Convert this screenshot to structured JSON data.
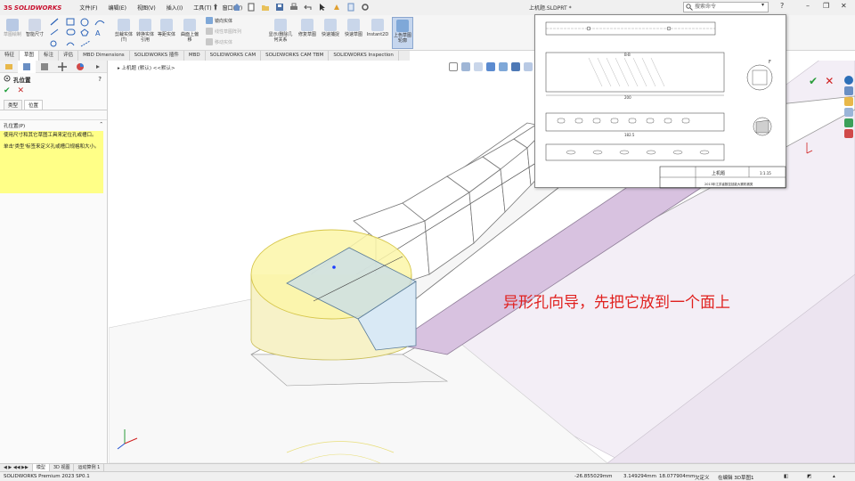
{
  "app": {
    "brand_prefix": "3S",
    "brand": "SOLIDWORKS",
    "document_title": "上机题.SLDPRT *",
    "search_placeholder": "搜索命令"
  },
  "menu": [
    "文件(F)",
    "编辑(E)",
    "视图(V)",
    "插入(I)",
    "工具(T)",
    "窗口(W)"
  ],
  "ribbon": {
    "smart_dim": "智能尺寸",
    "sketch_label": "草图绘制",
    "trim": "剪裁实体(T)",
    "convert": "转换实体引用",
    "offset": "等距实体",
    "surface_offset": "曲面上偏移",
    "mirror": "镜向实体",
    "linear_pattern": "线性草图阵列",
    "move": "移动实体",
    "show_relations": "显示/删除几何关系",
    "repair": "修复草图",
    "quick_snap": "快速捕捉",
    "quick_sketch": "快速草图",
    "instant2d": "Instant2D",
    "shaded_sketch": "上色草图轮廓"
  },
  "tabs": [
    "特征",
    "草图",
    "标注",
    "评估",
    "MBD Dimensions",
    "SOLIDWORKS 插件",
    "MBD",
    "SOLIDWORKS CAM",
    "SOLIDWORKS CAM TBM",
    "SOLIDWORKS Inspection"
  ],
  "active_tab": "草图",
  "property_manager": {
    "title": "孔位置",
    "ok_symbol": "✔",
    "cancel_symbol": "✕",
    "subtab_type": "类型",
    "subtab_position": "位置",
    "section_title": "孔位置(P)",
    "help_line1": "使用尺寸和其它草图工具来定位孔或槽口。",
    "help_line2": "单击'类型'标签来定义孔或槽口规格和大小。"
  },
  "viewport": {
    "breadcrumb": "上机题 (默认) <<默认>",
    "annotation": "异形孔向导，先把它放到一个面上"
  },
  "drawing": {
    "title_cell": "上机题",
    "scale": "1:1.15",
    "footer": "2013年江苏省数控技能大赛机械类",
    "dim1": "200",
    "dim2": "182.5",
    "section_label": "B-B",
    "detail_label": "F"
  },
  "bottom_tabs": [
    "模型",
    "3D 视图",
    "运动算例 1"
  ],
  "status": {
    "version": "SOLIDWORKS Premium 2023 SP0.1",
    "x": "-26.855029mm",
    "y": "3.149294mm",
    "z": "18.077904mm",
    "state": "欠定义",
    "editing": "在编辑 3D草图1"
  }
}
